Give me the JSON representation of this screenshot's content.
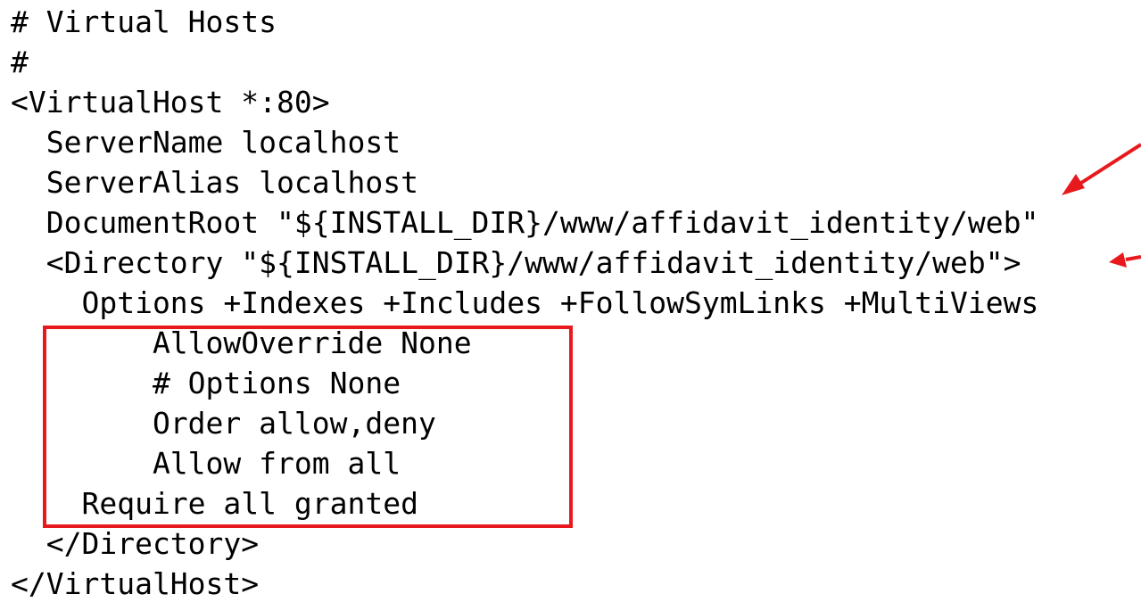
{
  "code": {
    "lines": [
      "# Virtual Hosts",
      "#",
      "<VirtualHost *:80>",
      "  ServerName localhost",
      "  ServerAlias localhost",
      "  DocumentRoot \"${INSTALL_DIR}/www/affidavit_identity/web\"",
      "  <Directory \"${INSTALL_DIR}/www/affidavit_identity/web\">",
      "    Options +Indexes +Includes +FollowSymLinks +MultiViews",
      "        AllowOverride None",
      "        # Options None",
      "        Order allow,deny",
      "        Allow from all",
      "    Require all granted",
      "  </Directory>",
      "</VirtualHost>"
    ]
  },
  "colors": {
    "annotation": "#e8191d",
    "text": "#000000",
    "background": "#ffffff"
  }
}
